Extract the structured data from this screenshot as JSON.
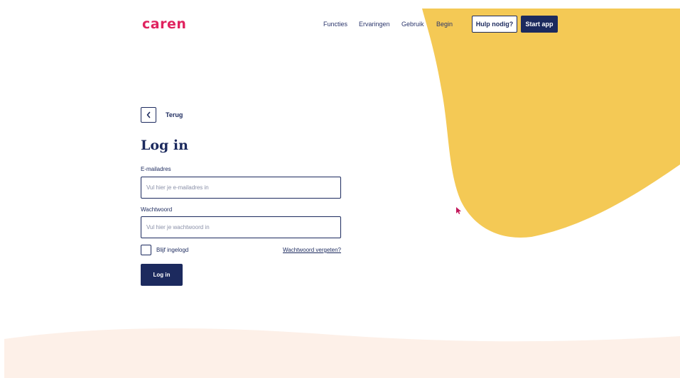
{
  "header": {
    "logo": "caren",
    "nav": [
      "Functies",
      "Ervaringen",
      "Gebruik",
      "Begin"
    ],
    "help_button": "Hulp nodig?",
    "start_button": "Start app"
  },
  "back": {
    "label": "Terug"
  },
  "form": {
    "title": "Log in",
    "email_label": "E-mailadres",
    "email_placeholder": "Vul hier je e-mailadres in",
    "email_value": "",
    "password_label": "Wachtwoord",
    "password_placeholder": "Vul hier je wachtwoord in",
    "password_value": "",
    "remember_label": "Blijf ingelogd",
    "remember_checked": false,
    "forgot_label": "Wachtwoord vergeten?",
    "submit_label": "Log in"
  },
  "colors": {
    "brand": "#e0235f",
    "navy": "#1c2a5e",
    "blob_yellow": "#f4c955",
    "bottom_wave": "#fdf0e8"
  }
}
